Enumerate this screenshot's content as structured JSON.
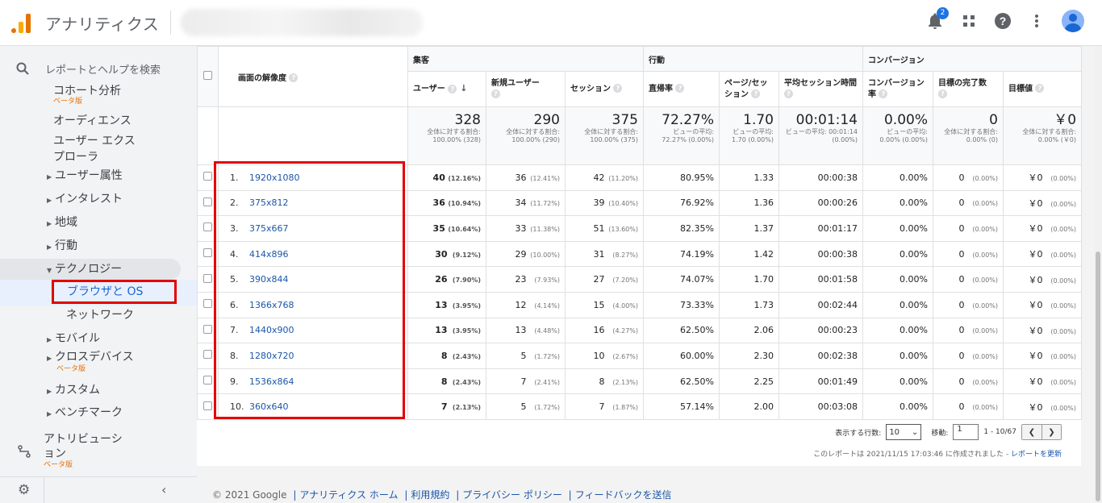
{
  "app": {
    "title": "アナリティクス"
  },
  "topbar": {
    "notification_count": "2"
  },
  "sidebar": {
    "search_placeholder": "レポートとヘルプを検索",
    "items": [
      {
        "label": "コホート分析",
        "beta": "ベータ版"
      },
      {
        "label": "オーディエンス"
      },
      {
        "label": "ユーザー エクスプローラ"
      },
      {
        "label": "ユーザー属性"
      },
      {
        "label": "インタレスト"
      },
      {
        "label": "地域"
      },
      {
        "label": "行動"
      },
      {
        "label": "テクノロジー"
      },
      {
        "label": "ブラウザと OS"
      },
      {
        "label": "ネットワーク"
      },
      {
        "label": "モバイル"
      },
      {
        "label": "クロスデバイス",
        "beta": "ベータ版"
      },
      {
        "label": "カスタム"
      },
      {
        "label": "ベンチマーク"
      }
    ],
    "attribution": {
      "label": "アトリビューション",
      "beta": "ベータ版"
    }
  },
  "table": {
    "groups": {
      "acquisition": "集客",
      "behavior": "行動",
      "conversion": "コンバージョン"
    },
    "dimension_header": "画面の解像度",
    "columns": {
      "users": "ユーザー",
      "new_users": "新規ユーザー",
      "sessions": "セッション",
      "bounce_rate": "直帰率",
      "pages_per_session": "ページ/セッション",
      "avg_session_duration": "平均セッション時間",
      "conversion_rate": "コンバージョン率",
      "goal_completions": "目標の完了数",
      "goal_value": "目標値"
    },
    "totals": {
      "users": {
        "value": "328",
        "note": "全体に対する割合: 100.00% (328)"
      },
      "new_users": {
        "value": "290",
        "note": "全体に対する割合: 100.00% (290)"
      },
      "sessions": {
        "value": "375",
        "note": "全体に対する割合: 100.00% (375)"
      },
      "bounce_rate": {
        "value": "72.27%",
        "note": "ビューの平均: 72.27% (0.00%)"
      },
      "pages_per_session": {
        "value": "1.70",
        "note": "ビューの平均: 1.70 (0.00%)"
      },
      "avg_session_duration": {
        "value": "00:01:14",
        "note": "ビューの平均: 00:01:14 (0.00%)"
      },
      "conversion_rate": {
        "value": "0.00%",
        "note": "ビューの平均: 0.00% (0.00%)"
      },
      "goal_completions": {
        "value": "0",
        "note": "全体に対する割合: 0.00% (0)"
      },
      "goal_value": {
        "value": "￥0",
        "note": "全体に対する割合: 0.00% (￥0)"
      }
    },
    "rows": [
      {
        "idx": "1.",
        "dim": "1920x1080",
        "users": "40",
        "users_pct": "(12.16%)",
        "new_users": "36",
        "new_users_pct": "(12.41%)",
        "sessions": "42",
        "sessions_pct": "(11.20%)",
        "bounce": "80.95%",
        "pps": "1.33",
        "dur": "00:00:38",
        "conv": "0.00%",
        "goals": "0",
        "goals_pct": "(0.00%)",
        "value": "￥0",
        "value_pct": "(0.00%)"
      },
      {
        "idx": "2.",
        "dim": "375x812",
        "users": "36",
        "users_pct": "(10.94%)",
        "new_users": "34",
        "new_users_pct": "(11.72%)",
        "sessions": "39",
        "sessions_pct": "(10.40%)",
        "bounce": "76.92%",
        "pps": "1.36",
        "dur": "00:00:26",
        "conv": "0.00%",
        "goals": "0",
        "goals_pct": "(0.00%)",
        "value": "￥0",
        "value_pct": "(0.00%)"
      },
      {
        "idx": "3.",
        "dim": "375x667",
        "users": "35",
        "users_pct": "(10.64%)",
        "new_users": "33",
        "new_users_pct": "(11.38%)",
        "sessions": "51",
        "sessions_pct": "(13.60%)",
        "bounce": "82.35%",
        "pps": "1.37",
        "dur": "00:01:17",
        "conv": "0.00%",
        "goals": "0",
        "goals_pct": "(0.00%)",
        "value": "￥0",
        "value_pct": "(0.00%)"
      },
      {
        "idx": "4.",
        "dim": "414x896",
        "users": "30",
        "users_pct": "(9.12%)",
        "new_users": "29",
        "new_users_pct": "(10.00%)",
        "sessions": "31",
        "sessions_pct": "(8.27%)",
        "bounce": "74.19%",
        "pps": "1.42",
        "dur": "00:00:38",
        "conv": "0.00%",
        "goals": "0",
        "goals_pct": "(0.00%)",
        "value": "￥0",
        "value_pct": "(0.00%)"
      },
      {
        "idx": "5.",
        "dim": "390x844",
        "users": "26",
        "users_pct": "(7.90%)",
        "new_users": "23",
        "new_users_pct": "(7.93%)",
        "sessions": "27",
        "sessions_pct": "(7.20%)",
        "bounce": "74.07%",
        "pps": "1.70",
        "dur": "00:01:58",
        "conv": "0.00%",
        "goals": "0",
        "goals_pct": "(0.00%)",
        "value": "￥0",
        "value_pct": "(0.00%)"
      },
      {
        "idx": "6.",
        "dim": "1366x768",
        "users": "13",
        "users_pct": "(3.95%)",
        "new_users": "12",
        "new_users_pct": "(4.14%)",
        "sessions": "15",
        "sessions_pct": "(4.00%)",
        "bounce": "73.33%",
        "pps": "1.73",
        "dur": "00:02:44",
        "conv": "0.00%",
        "goals": "0",
        "goals_pct": "(0.00%)",
        "value": "￥0",
        "value_pct": "(0.00%)"
      },
      {
        "idx": "7.",
        "dim": "1440x900",
        "users": "13",
        "users_pct": "(3.95%)",
        "new_users": "13",
        "new_users_pct": "(4.48%)",
        "sessions": "16",
        "sessions_pct": "(4.27%)",
        "bounce": "62.50%",
        "pps": "2.06",
        "dur": "00:00:23",
        "conv": "0.00%",
        "goals": "0",
        "goals_pct": "(0.00%)",
        "value": "￥0",
        "value_pct": "(0.00%)"
      },
      {
        "idx": "8.",
        "dim": "1280x720",
        "users": "8",
        "users_pct": "(2.43%)",
        "new_users": "5",
        "new_users_pct": "(1.72%)",
        "sessions": "10",
        "sessions_pct": "(2.67%)",
        "bounce": "60.00%",
        "pps": "2.30",
        "dur": "00:02:38",
        "conv": "0.00%",
        "goals": "0",
        "goals_pct": "(0.00%)",
        "value": "￥0",
        "value_pct": "(0.00%)"
      },
      {
        "idx": "9.",
        "dim": "1536x864",
        "users": "8",
        "users_pct": "(2.43%)",
        "new_users": "7",
        "new_users_pct": "(2.41%)",
        "sessions": "8",
        "sessions_pct": "(2.13%)",
        "bounce": "62.50%",
        "pps": "2.25",
        "dur": "00:01:49",
        "conv": "0.00%",
        "goals": "0",
        "goals_pct": "(0.00%)",
        "value": "￥0",
        "value_pct": "(0.00%)"
      },
      {
        "idx": "10.",
        "dim": "360x640",
        "users": "7",
        "users_pct": "(2.13%)",
        "new_users": "5",
        "new_users_pct": "(1.72%)",
        "sessions": "7",
        "sessions_pct": "(1.87%)",
        "bounce": "57.14%",
        "pps": "2.00",
        "dur": "00:03:08",
        "conv": "0.00%",
        "goals": "0",
        "goals_pct": "(0.00%)",
        "value": "￥0",
        "value_pct": "(0.00%)"
      }
    ]
  },
  "pager": {
    "rows_label": "表示する行数:",
    "rows_value": "10",
    "goto_label": "移動:",
    "goto_value": "1",
    "range": "1 - 10/67"
  },
  "generated": {
    "text": "このレポートは 2021/11/15 17:03:46 に作成されました - ",
    "link": "レポートを更新"
  },
  "footer": {
    "copyright": "© 2021 Google",
    "links": [
      "アナリティクス ホーム",
      "利用規約",
      "プライバシー ポリシー",
      "フィードバックを送信"
    ]
  },
  "colors": {
    "accent": "#1a73e8",
    "highlight_border": "#e50000",
    "beta": "#e8710a"
  }
}
